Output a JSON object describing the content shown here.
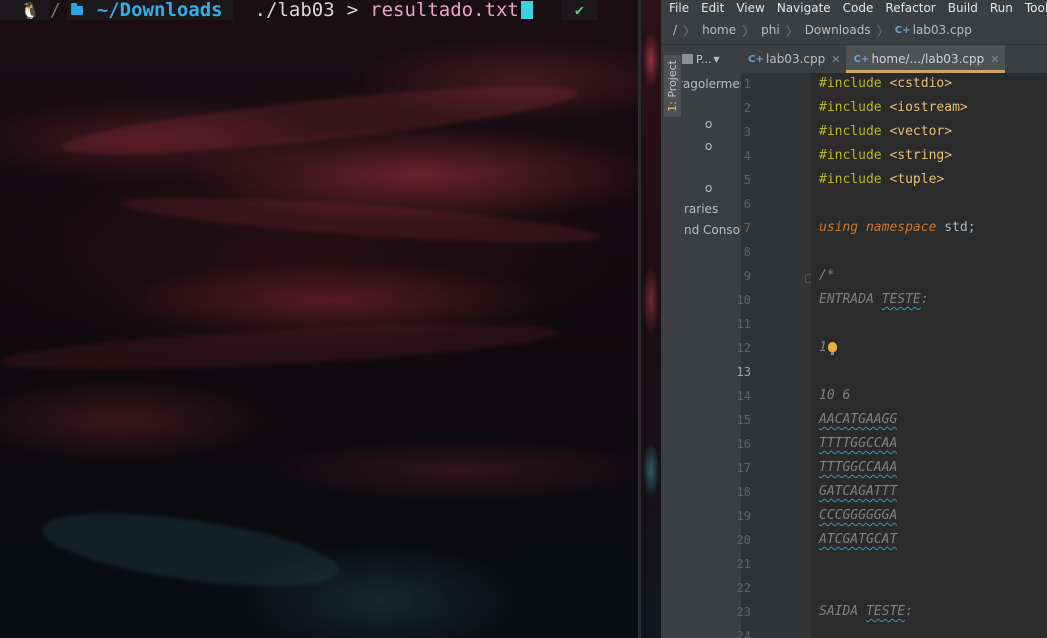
{
  "terminal": {
    "directory": "~/Downloads",
    "command": "./lab03",
    "redirect": ">",
    "argument": "resultado.txt",
    "status": "✔"
  },
  "ide": {
    "menu": [
      "File",
      "Edit",
      "View",
      "Navigate",
      "Code",
      "Refactor",
      "Build",
      "Run",
      "Tools"
    ],
    "breadcrumbs": [
      "/",
      "home",
      "phi",
      "Downloads",
      "lab03.cpp"
    ],
    "tool_window": {
      "number": "1:",
      "label": "Project"
    },
    "project_panel": {
      "tab": "P...",
      "items": [
        "ragolermer",
        "o",
        "o",
        "o",
        "raries",
        "nd Console"
      ]
    },
    "tabs": [
      {
        "label": "lab03.cpp",
        "active": false
      },
      {
        "label": "home/.../lab03.cpp",
        "active": true
      }
    ],
    "current_line": 13,
    "code_lines": [
      {
        "n": "1",
        "parts": [
          [
            "pp",
            "#include "
          ],
          [
            "hdr",
            "<cstdio>"
          ]
        ]
      },
      {
        "n": "2",
        "parts": [
          [
            "pp",
            "#include "
          ],
          [
            "hdr",
            "<iostream>"
          ]
        ]
      },
      {
        "n": "3",
        "parts": [
          [
            "pp",
            "#include "
          ],
          [
            "hdr",
            "<vector>"
          ]
        ]
      },
      {
        "n": "4",
        "parts": [
          [
            "pp",
            "#include "
          ],
          [
            "hdr",
            "<string>"
          ]
        ]
      },
      {
        "n": "5",
        "parts": [
          [
            "pp",
            "#include "
          ],
          [
            "hdr",
            "<tuple>"
          ]
        ]
      },
      {
        "n": "6",
        "parts": []
      },
      {
        "n": "7",
        "parts": [
          [
            "using",
            "using namespace "
          ],
          [
            "std",
            "std;"
          ]
        ]
      },
      {
        "n": "8",
        "parts": []
      },
      {
        "n": "9",
        "parts": [
          [
            "cmt",
            "/*"
          ]
        ]
      },
      {
        "n": "10",
        "parts": [
          [
            "cmt",
            "ENTRADA "
          ],
          [
            "cmtsq",
            "TESTE"
          ],
          [
            "cmt",
            ":"
          ]
        ]
      },
      {
        "n": "11",
        "parts": []
      },
      {
        "n": "12",
        "parts": [
          [
            "cmt",
            "1"
          ],
          [
            "bulb",
            ""
          ]
        ]
      },
      {
        "n": "13",
        "parts": []
      },
      {
        "n": "14",
        "parts": [
          [
            "cmt",
            "10 6"
          ]
        ]
      },
      {
        "n": "15",
        "parts": [
          [
            "cmtsq",
            "AACATGAAGG"
          ]
        ]
      },
      {
        "n": "16",
        "parts": [
          [
            "cmtsq",
            "TTTTGGCCAA"
          ]
        ]
      },
      {
        "n": "17",
        "parts": [
          [
            "cmtsq",
            "TTTGGCCAAA"
          ]
        ]
      },
      {
        "n": "18",
        "parts": [
          [
            "cmtsq",
            "GATCAGATTT"
          ]
        ]
      },
      {
        "n": "19",
        "parts": [
          [
            "cmtsq",
            "CCCGGGGGGA"
          ]
        ]
      },
      {
        "n": "20",
        "parts": [
          [
            "cmtsq",
            "ATCGATGCAT"
          ]
        ]
      },
      {
        "n": "21",
        "parts": []
      },
      {
        "n": "22",
        "parts": []
      },
      {
        "n": "23",
        "parts": [
          [
            "cmt",
            "SAIDA "
          ],
          [
            "cmtsq",
            "TESTE"
          ],
          [
            "cmt",
            ":"
          ]
        ]
      },
      {
        "n": "24",
        "parts": []
      }
    ]
  }
}
